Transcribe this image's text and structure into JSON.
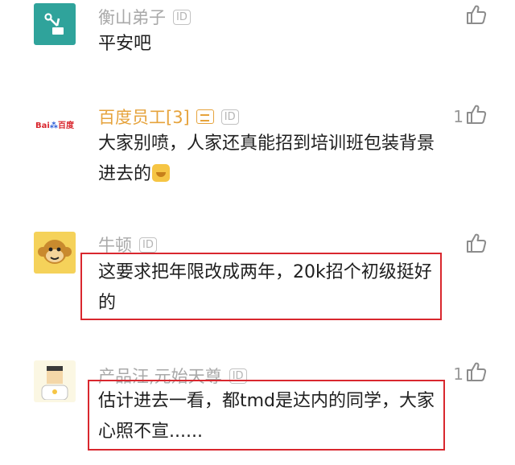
{
  "comments": [
    {
      "author": "衡山弟子",
      "id_badge": "ID",
      "text": "平安吧",
      "likes": "",
      "avatar": "robot-arm-icon"
    },
    {
      "author": "百度员工[3]",
      "id_badge": "ID",
      "text": "大家别喷，人家还真能招到培训班包装背景进去的",
      "likes": "1",
      "avatar": "baidu-logo",
      "avatar_text": "Bai百度",
      "emoji": "laughing-emoji"
    },
    {
      "author": "牛顿",
      "id_badge": "ID",
      "text": "这要求把年限改成两年，20k招个初级挺好的",
      "likes": "",
      "avatar": "monkey-avatar"
    },
    {
      "author": "产品汪,元始天尊",
      "id_badge": "ID",
      "text": "估计进去一看，都tmd是达内的同学，大家心照不宣......",
      "likes": "1",
      "avatar": "person-avatar"
    }
  ],
  "colors": {
    "name": "#a9a9a9",
    "vip_name": "#e6a33c",
    "highlight": "#d9272e",
    "text": "#1f1f1f"
  }
}
